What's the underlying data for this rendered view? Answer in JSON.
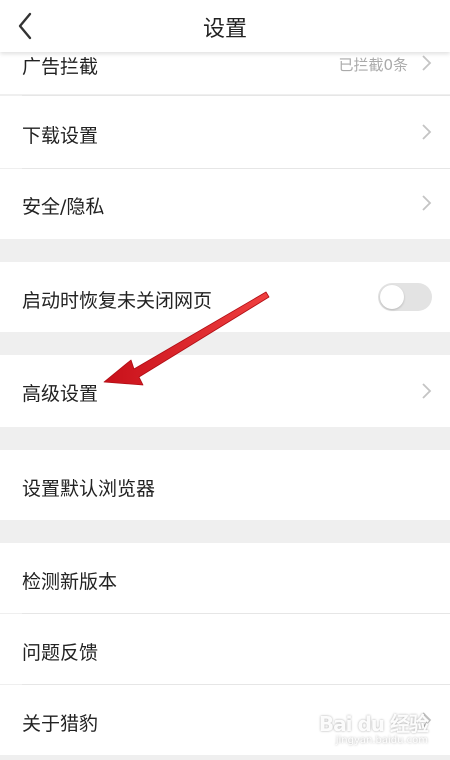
{
  "header": {
    "title": "设置",
    "back_icon": "chevron-left-icon"
  },
  "rows": {
    "ad_block": {
      "label": "广告拦截",
      "value": "已拦截0条"
    },
    "download": {
      "label": "下载设置"
    },
    "security": {
      "label": "安全/隐私"
    },
    "restore": {
      "label": "启动时恢复未关闭网页",
      "toggle_on": false
    },
    "advanced": {
      "label": "高级设置"
    },
    "default_browser": {
      "label": "设置默认浏览器"
    },
    "check_update": {
      "label": "检测新版本"
    },
    "feedback": {
      "label": "问题反馈"
    },
    "about": {
      "label": "关于猎豹"
    }
  },
  "annotation": {
    "icon": "red-arrow-icon",
    "color": "#e0151b"
  },
  "watermark": {
    "logo": "Bai du 经验",
    "sub": "jingyan.baidu.com"
  },
  "colors": {
    "accent_arrow": "#e0151b",
    "page_bg": "#efefef",
    "toggle_off": "#e3e3e3"
  }
}
